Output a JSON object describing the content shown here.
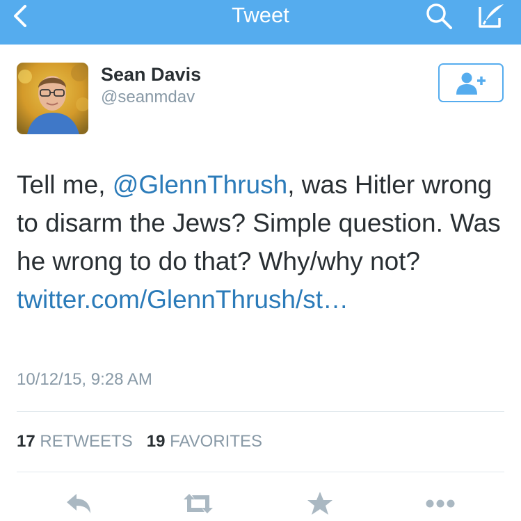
{
  "navbar": {
    "title": "Tweet",
    "icons": [
      "back-chevron-icon",
      "search-icon",
      "compose-icon"
    ],
    "color": "#55acee"
  },
  "author": {
    "name": "Sean Davis",
    "handle": "@seanmdav",
    "follow_icon": "add-user-icon"
  },
  "tweet": {
    "text_start": "Tell me, ",
    "mention": "@GlennThrush",
    "text_middle": ", was Hitler wrong to disarm the Jews? Simple question. Was he wrong to do that? Why/why not? ",
    "link": "twitter.com/GlennThrush/st…",
    "timestamp": "10/12/15, 9:28 AM"
  },
  "stats": {
    "retweets_count": "17",
    "retweets_label": "RETWEETS",
    "favorites_count": "19",
    "favorites_label": "FAVORITES"
  },
  "actions": [
    "reply-icon",
    "retweet-icon",
    "favorite-icon",
    "more-icon"
  ],
  "colors": {
    "accent": "#55acee",
    "link": "#2b7bb9",
    "text": "#292f33",
    "muted": "#8899a6",
    "action_icon": "#aab8c2"
  }
}
